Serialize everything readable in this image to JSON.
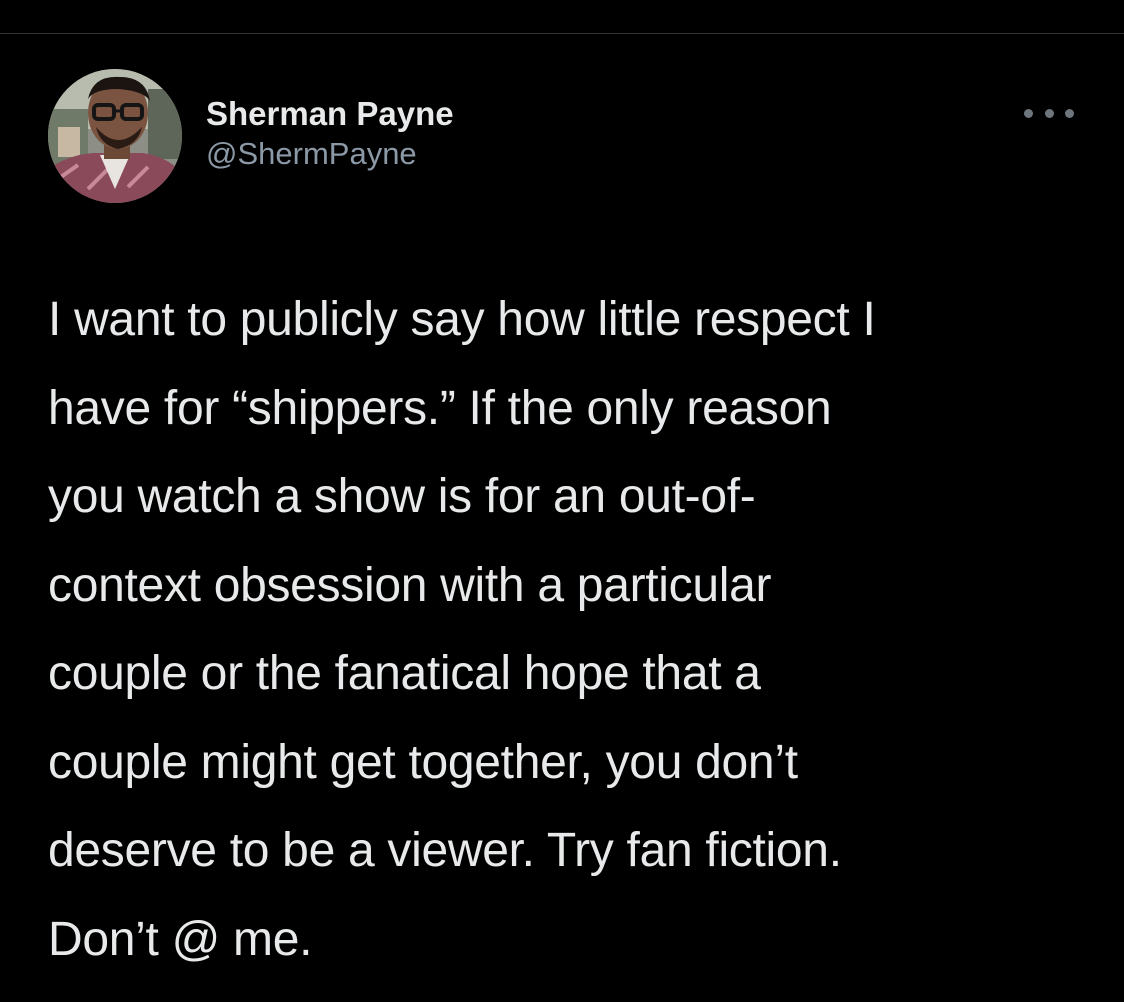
{
  "tweet": {
    "author": {
      "display_name": "Sherman Payne",
      "handle": "@ShermPayne"
    },
    "more_icon": "ellipsis-icon",
    "text_lines": [
      "I want to publicly say how little respect I",
      "have for “shippers.” If the only reason",
      "you watch a show is for an out-of-",
      "context obsession with a particular",
      "couple or the fanatical hope that a",
      "couple might get together, you don’t",
      "deserve to be a viewer. Try fan fiction.",
      "Don’t @ me."
    ]
  },
  "colors": {
    "background": "#000000",
    "primary_text": "#e7e9ea",
    "secondary_text": "#8b98a5",
    "divider": "#2f3336"
  }
}
